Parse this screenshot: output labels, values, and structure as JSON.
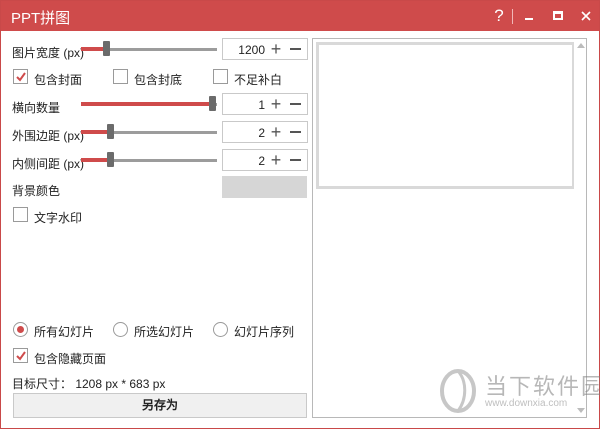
{
  "window": {
    "title": "PPT拼图",
    "help_label": "?"
  },
  "settings": {
    "width": {
      "label": "图片宽度 (px)",
      "value": "1200",
      "slider_level": 0.16
    },
    "include_cover": {
      "label": "包含封面",
      "checked": true
    },
    "include_back_cover": {
      "label": "包含封底",
      "checked": false
    },
    "fill_missing": {
      "label": "不足补白",
      "checked": false
    },
    "columns": {
      "label": "横向数量",
      "value": "1",
      "slider_level": 1.0
    },
    "outer_margin": {
      "label": "外围边距 (px)",
      "value": "2",
      "slider_level": 0.2
    },
    "inner_spacing": {
      "label": "内侧间距 (px)",
      "value": "2",
      "slider_level": 0.2
    },
    "background_color": {
      "label": "背景颜色",
      "color": "#d6d6d6"
    },
    "text_watermark": {
      "label": "文字水印",
      "checked": false
    }
  },
  "slide_scope": {
    "options": [
      {
        "label": "所有幻灯片",
        "selected": true
      },
      {
        "label": "所选幻灯片",
        "selected": false
      },
      {
        "label": "幻灯片序列",
        "selected": false
      }
    ]
  },
  "include_hidden": {
    "label": "包含隐藏页面",
    "checked": true
  },
  "target_size": "目标尺寸： 1208 px * 683 px",
  "save_button": "另存为",
  "watermark": {
    "name": "当下软件园",
    "url": "www.downxia.com"
  },
  "colors": {
    "accent": "#cf4b4b",
    "titlebar": "#cf4b4b"
  }
}
